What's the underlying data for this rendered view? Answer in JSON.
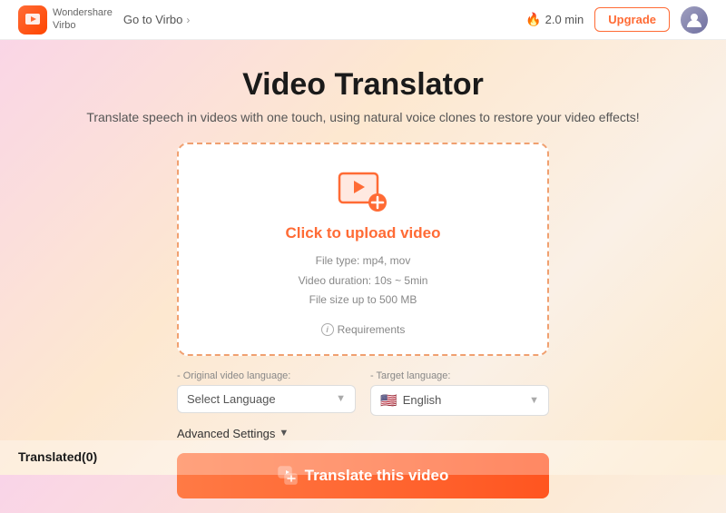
{
  "header": {
    "logo_line1": "Wondershare",
    "logo_line2": "Virbo",
    "goto_label": "Go to Virbo",
    "minutes_label": "2.0 min",
    "upgrade_label": "Upgrade"
  },
  "main": {
    "title": "Video Translator",
    "subtitle": "Translate speech in videos with one touch, using natural voice clones to restore your video effects!",
    "upload": {
      "label": "Click to upload video",
      "file_type": "File type: mp4, mov",
      "duration": "Video duration: 10s ~ 5min",
      "file_size": "File size up to 500 MB",
      "requirements": "Requirements"
    },
    "original_lang": {
      "label": "- Original video language:",
      "placeholder": "Select Language"
    },
    "target_lang": {
      "label": "- Target language:",
      "value": "English",
      "flag": "🇺🇸"
    },
    "advanced_settings": "Advanced Settings",
    "translate_btn": "Translate this video"
  },
  "bottom": {
    "translated_label": "Translated(0)"
  }
}
